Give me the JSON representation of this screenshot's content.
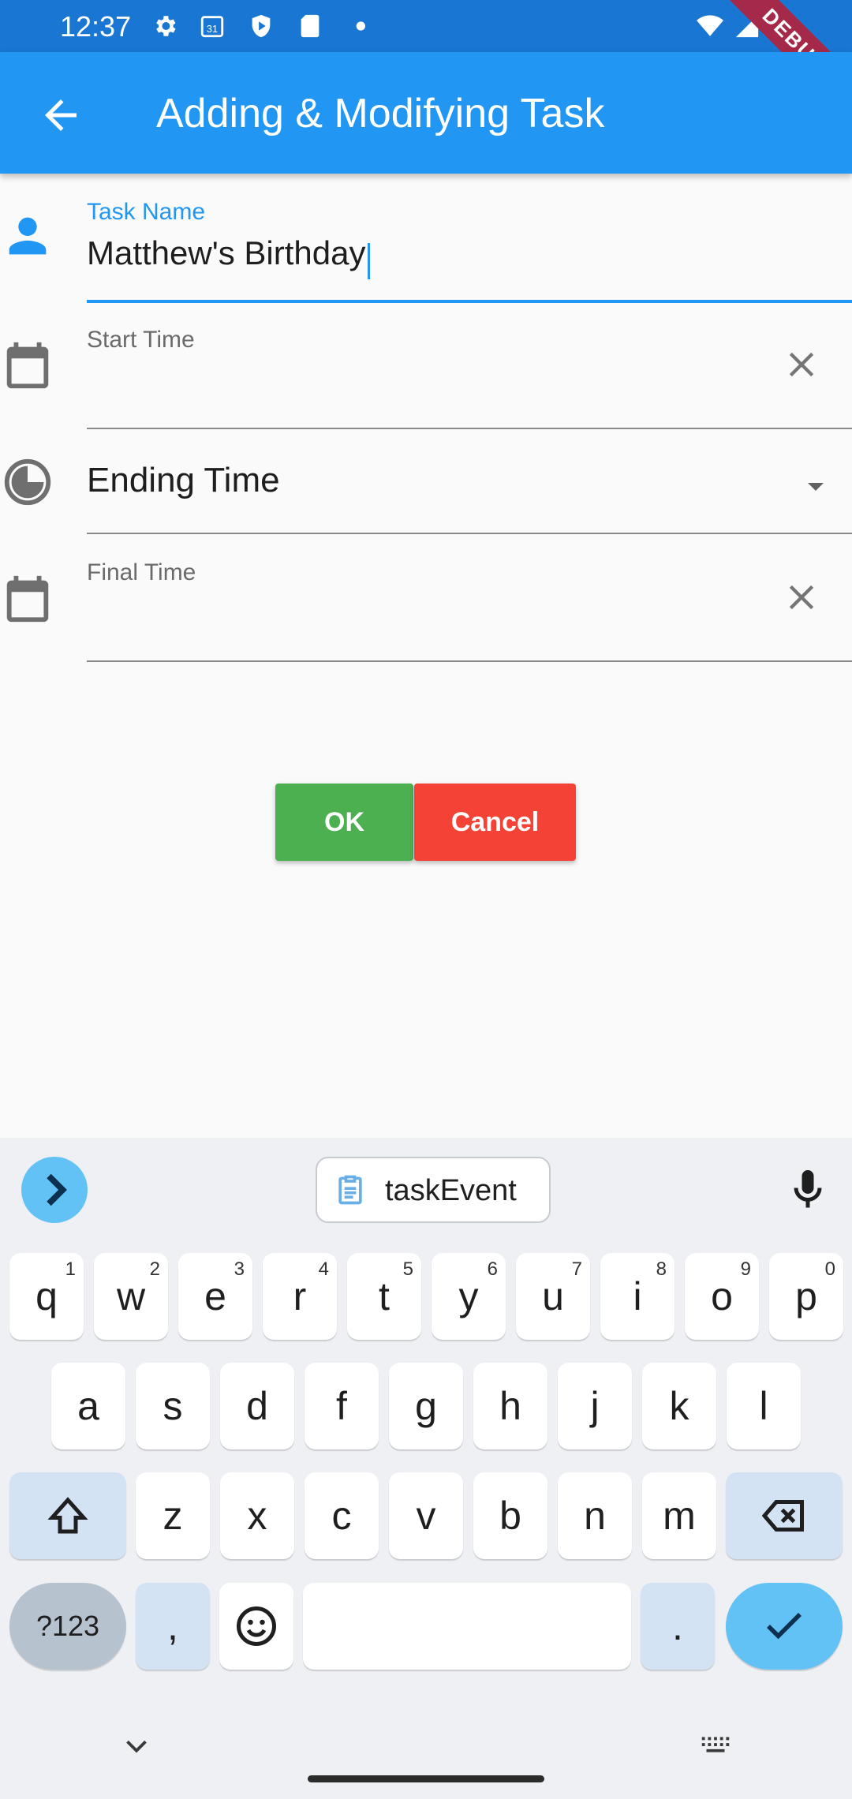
{
  "status_bar": {
    "time": "12:37",
    "calendar_day": "31",
    "debug_banner": "DEBUG"
  },
  "app_bar": {
    "title": "Adding & Modifying Task"
  },
  "form": {
    "task_name": {
      "label": "Task Name",
      "value": "Matthew's Birthday"
    },
    "start_time": {
      "label": "Start Time",
      "value": ""
    },
    "ending_time": {
      "selected": "Ending Time"
    },
    "final_time": {
      "label": "Final Time",
      "value": ""
    }
  },
  "buttons": {
    "ok": "OK",
    "cancel": "Cancel"
  },
  "colors": {
    "primary": "#2196f3",
    "status_bar": "#1976d2",
    "ok": "#4caf50",
    "cancel": "#f44336"
  },
  "keyboard": {
    "suggestion": "taskEvent",
    "row1": [
      {
        "k": "q",
        "n": "1"
      },
      {
        "k": "w",
        "n": "2"
      },
      {
        "k": "e",
        "n": "3"
      },
      {
        "k": "r",
        "n": "4"
      },
      {
        "k": "t",
        "n": "5"
      },
      {
        "k": "y",
        "n": "6"
      },
      {
        "k": "u",
        "n": "7"
      },
      {
        "k": "i",
        "n": "8"
      },
      {
        "k": "o",
        "n": "9"
      },
      {
        "k": "p",
        "n": "0"
      }
    ],
    "row2": [
      "a",
      "s",
      "d",
      "f",
      "g",
      "h",
      "j",
      "k",
      "l"
    ],
    "row3": [
      "z",
      "x",
      "c",
      "v",
      "b",
      "n",
      "m"
    ],
    "symbols_key": "?123",
    "comma_key": ",",
    "period_key": "."
  }
}
